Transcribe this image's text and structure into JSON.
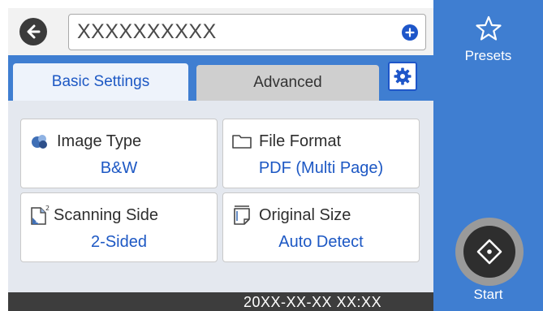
{
  "header": {
    "destination_value": "XXXXXXXXXX"
  },
  "tabs": [
    {
      "label": "Basic Settings",
      "selected": true
    },
    {
      "label": "Advanced",
      "selected": false
    }
  ],
  "settings": {
    "image_type": {
      "label": "Image Type",
      "value": "B&W"
    },
    "file_format": {
      "label": "File Format",
      "value": "PDF (Multi Page)"
    },
    "scanning_side": {
      "label": "Scanning Side",
      "value": "2-Sided"
    },
    "original_size": {
      "label": "Original Size",
      "value": "Auto Detect"
    }
  },
  "sidebar": {
    "presets_label": "Presets",
    "start_label": "Start"
  },
  "status": {
    "datetime": "20XX-XX-XX XX:XX"
  },
  "colors": {
    "accent_blue": "#3f7ed1",
    "link_blue": "#1d58c4",
    "status_bar": "#3d3d3d"
  },
  "icons": [
    "back-arrow-icon",
    "add-icon",
    "gear-icon",
    "image-type-icon",
    "folder-icon",
    "scanning-side-icon",
    "original-size-icon",
    "star-icon",
    "start-diamond-icon"
  ]
}
